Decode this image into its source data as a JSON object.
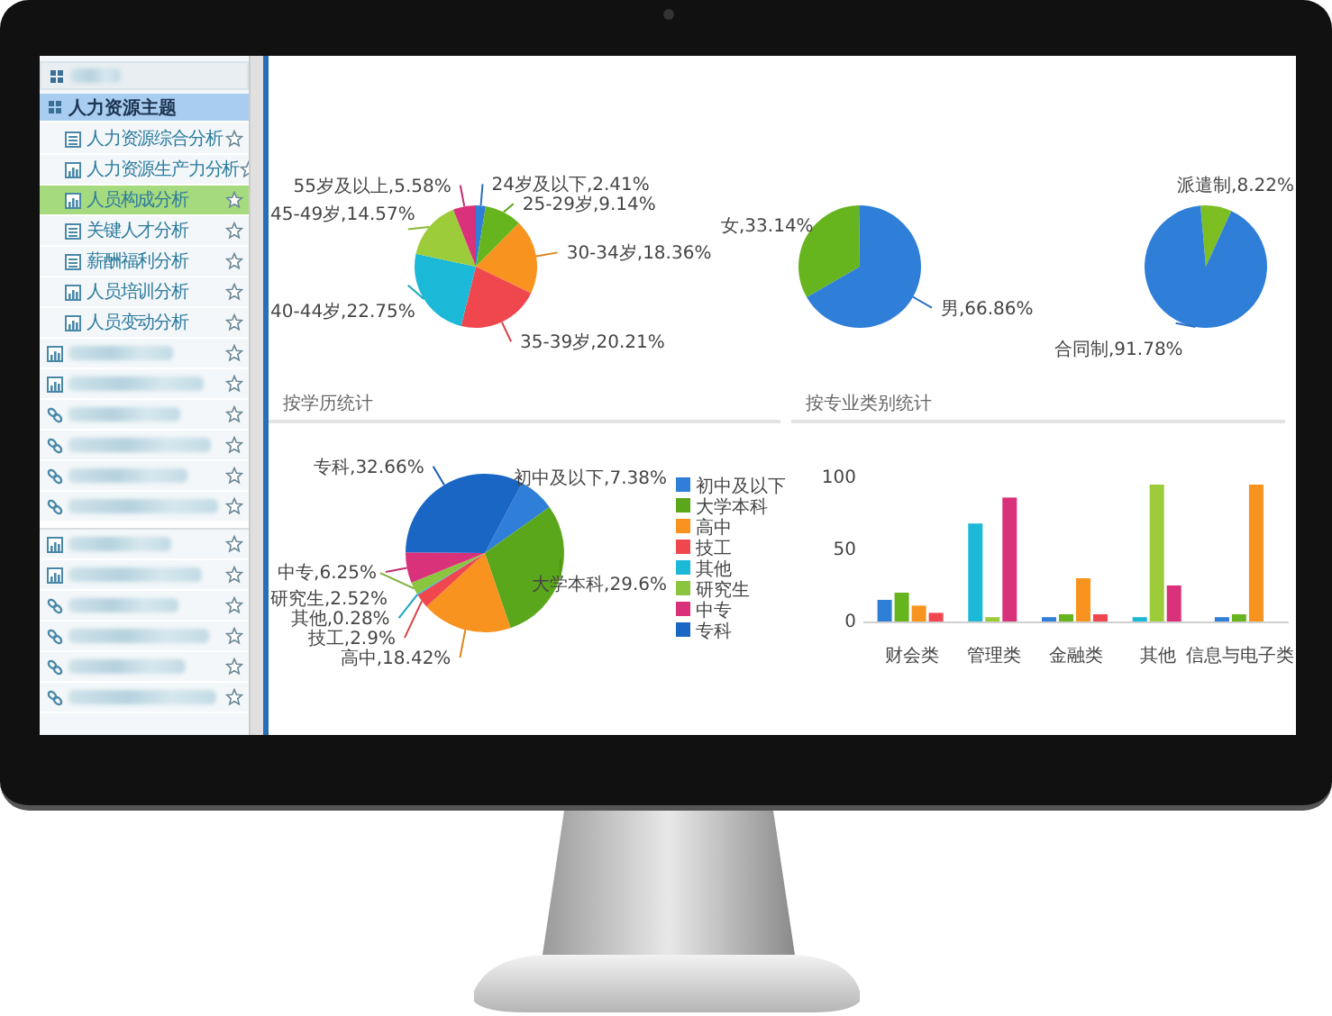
{
  "sidebar": {
    "rows": [
      {
        "kind": "blurred-header"
      },
      {
        "kind": "group",
        "label": "人力资源主题"
      },
      {
        "kind": "table-item",
        "label": "人力资源综合分析",
        "selected": false,
        "starred": false
      },
      {
        "kind": "chart-item",
        "label": "人力资源生产力分析",
        "selected": false,
        "starred": false
      },
      {
        "kind": "chart-item",
        "label": "人员构成分析",
        "selected": true,
        "starred": false
      },
      {
        "kind": "table-item",
        "label": "关键人才分析",
        "selected": false,
        "starred": false
      },
      {
        "kind": "table-item",
        "label": "薪酬福利分析",
        "selected": false,
        "starred": false
      },
      {
        "kind": "chart-item",
        "label": "人员培训分析",
        "selected": false,
        "starred": false
      },
      {
        "kind": "chart-item",
        "label": "人员变动分析",
        "selected": false,
        "starred": false
      },
      {
        "kind": "blurred-chart",
        "selected": false,
        "starred": false
      },
      {
        "kind": "blurred-chart",
        "selected": false,
        "starred": false
      },
      {
        "kind": "blurred-link",
        "selected": false,
        "starred": false
      },
      {
        "kind": "blurred-link",
        "selected": false,
        "starred": false
      },
      {
        "kind": "blurred-link",
        "selected": false,
        "starred": false
      },
      {
        "kind": "blurred-link",
        "selected": false,
        "starred": false
      },
      {
        "kind": "separator"
      },
      {
        "kind": "blurred-chart",
        "selected": false,
        "starred": false
      },
      {
        "kind": "blurred-chart",
        "selected": false,
        "starred": false
      },
      {
        "kind": "blurred-link",
        "selected": false,
        "starred": false
      },
      {
        "kind": "blurred-link",
        "selected": false,
        "starred": false
      },
      {
        "kind": "blurred-link",
        "selected": false,
        "starred": false
      },
      {
        "kind": "blurred-link",
        "selected": false,
        "starred": false
      }
    ]
  },
  "top_charts": [
    {
      "chart_data": {
        "type": "pie",
        "categories": [
          "24岁及以下,2.41%",
          "25-29岁,9.14%",
          "30-34岁,18.36%",
          "35-39岁,20.21%",
          "40-44岁,22.75%",
          "45-49岁,14.57%",
          "55岁及以上,5.58%"
        ],
        "series": [
          {
            "values": [
              2.41,
              9.14,
              18.36,
              20.21,
              22.75,
              14.57,
              5.58
            ],
            "colors": [
              "#2f7ed8",
              "#66b51e",
              "#f7931e",
              "#f0474f",
              "#1cb8d8",
              "#9ccc3a",
              "#d9317a"
            ]
          }
        ]
      }
    },
    {
      "chart_data": {
        "type": "pie",
        "categories": [
          "女,33.14%",
          "男,66.86%"
        ],
        "series": [
          {
            "values": [
              33.14,
              66.86
            ],
            "colors": [
              "#66b51e",
              "#2f7ed8"
            ]
          }
        ]
      }
    },
    {
      "chart_data": {
        "type": "pie",
        "categories": [
          "派遣制,8.22%",
          "合同制,91.78%"
        ],
        "series": [
          {
            "values": [
              8.22,
              91.78
            ],
            "colors": [
              "#7dbf22",
              "#2f7ed8"
            ]
          }
        ]
      }
    }
  ],
  "education": {
    "title": "按学历统计",
    "chart_data": {
      "type": "pie",
      "categories": [
        "初中及以下",
        "大学本科",
        "高中",
        "技工",
        "其他",
        "研究生",
        "中专",
        "专科"
      ],
      "series": [
        {
          "values": [
            7.38,
            29.6,
            18.42,
            2.9,
            0.28,
            2.52,
            6.25,
            32.66
          ],
          "colors": [
            "#2f7ed8",
            "#5ba71b",
            "#f7931e",
            "#f0474f",
            "#1cb8d8",
            "#8bc43f",
            "#d9317a",
            "#1a66c4"
          ]
        }
      ],
      "value_labels": [
        "初中及以下,7.38%",
        "大学本科,29.6%",
        "高中,18.42%",
        "技工,2.9%",
        "其他,0.28%",
        "研究生,2.52%",
        "中专,6.25%",
        "专科,32.66%"
      ],
      "legend": true
    }
  },
  "major": {
    "title": "按专业类别统计",
    "chart_data": {
      "type": "bar",
      "categories": [
        "财会类",
        "管理类",
        "金融类",
        "其他",
        "信息与电子类"
      ],
      "yticks": [
        0,
        50,
        100
      ],
      "ylim": [
        0,
        100
      ],
      "series": [
        {
          "color": "#2f7ed8",
          "values": [
            15,
            null,
            3,
            null,
            3
          ]
        },
        {
          "color": "#66b51e",
          "values": [
            20,
            null,
            5,
            null,
            5
          ]
        },
        {
          "color": "#f7931e",
          "values": [
            11,
            null,
            30,
            null,
            95
          ]
        },
        {
          "color": "#f0474f",
          "values": [
            6,
            null,
            5,
            null,
            null
          ]
        },
        {
          "color": "#1cb8d8",
          "values": [
            null,
            68,
            null,
            3,
            null
          ]
        },
        {
          "color": "#9ccc3a",
          "values": [
            null,
            3,
            null,
            95,
            null
          ]
        },
        {
          "color": "#d9317a",
          "values": [
            null,
            86,
            null,
            25,
            null
          ]
        }
      ]
    }
  }
}
